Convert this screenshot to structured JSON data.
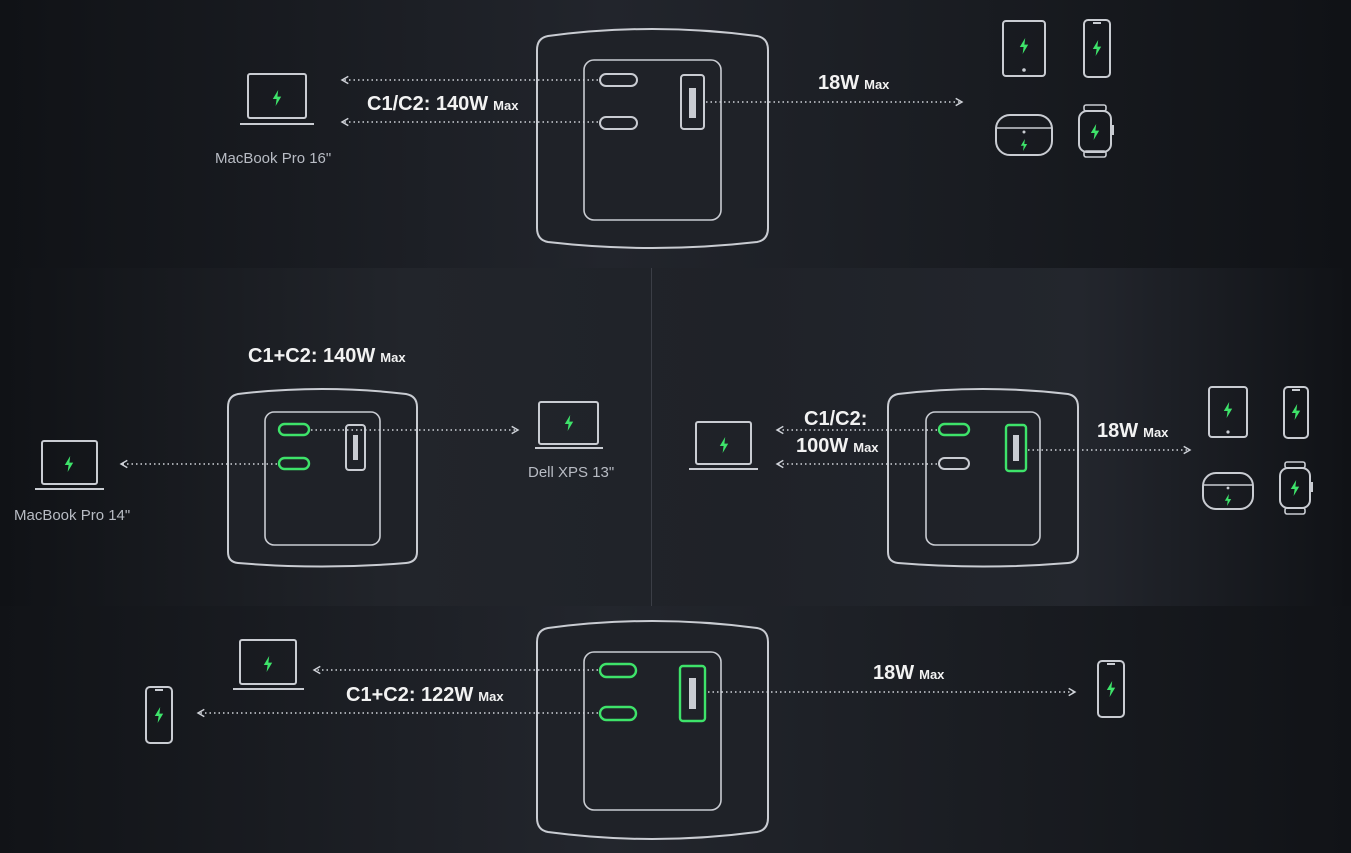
{
  "theme": {
    "accent": "#3ee36a",
    "line": "#d0d3d9",
    "device": "#c9ccd2"
  },
  "icons": [
    "laptop-icon",
    "tablet-icon",
    "phone-icon",
    "earbuds-case-icon",
    "smartwatch-icon",
    "charger-icon",
    "bolt-icon"
  ],
  "scenarios": {
    "top": {
      "left_output": {
        "label": "C1/C2: 140W",
        "suffix": "Max"
      },
      "right_output": {
        "label": "18W",
        "suffix": "Max"
      },
      "left_device": "MacBook Pro 16\""
    },
    "middle_left": {
      "output": {
        "label": "C1+C2: 140W",
        "suffix": "Max"
      },
      "left_device": "MacBook Pro 14\"",
      "right_device": "Dell XPS 13\""
    },
    "middle_right": {
      "left_output": {
        "line1": "C1/C2:",
        "line2": "100W",
        "suffix": "Max"
      },
      "right_output": {
        "label": "18W",
        "suffix": "Max"
      }
    },
    "bottom": {
      "left_output": {
        "label": "C1+C2: 122W",
        "suffix": "Max"
      },
      "right_output": {
        "label": "18W",
        "suffix": "Max"
      }
    }
  }
}
